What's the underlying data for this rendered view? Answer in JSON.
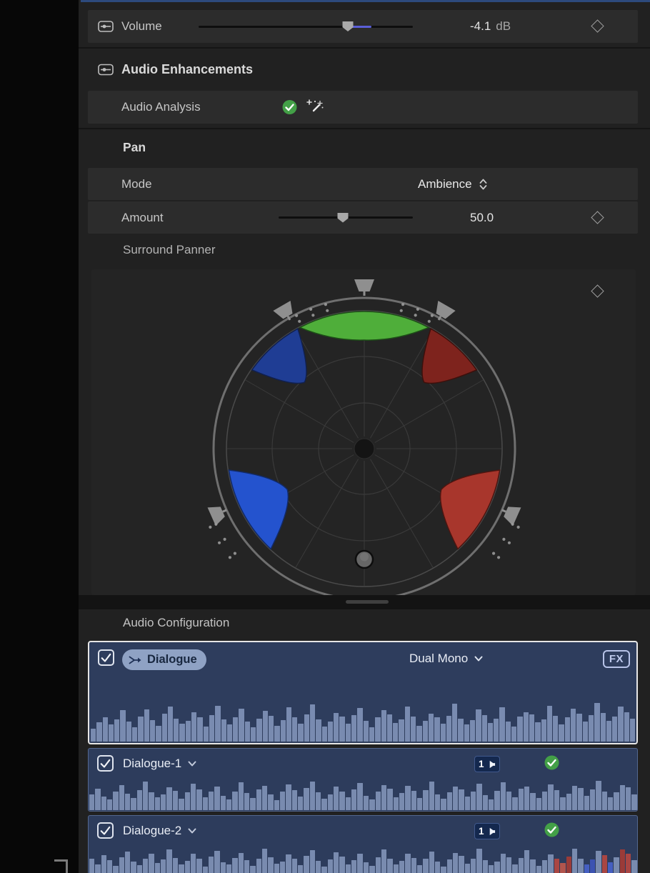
{
  "colors": {
    "accent_blue": "#5b5fd8",
    "selection_border": "#e6e6e6",
    "waveform": "#8a9cc2",
    "check_green": "#43a047"
  },
  "inspector": {
    "volume": {
      "label": "Volume",
      "value": "-4.1",
      "unit": "dB"
    },
    "audio_enhancements": {
      "title": "Audio Enhancements",
      "audio_analysis_label": "Audio Analysis"
    },
    "pan": {
      "title": "Pan",
      "mode_label": "Mode",
      "mode_value": "Ambience",
      "amount_label": "Amount",
      "amount_value": "50.0",
      "surround_panner_label": "Surround Panner"
    },
    "audio_configuration_title": "Audio Configuration"
  },
  "surround_panner": {
    "ring_color": "#6f6f6f",
    "circle_color": "#4a4a4a",
    "grid_color": "#3a3a3a",
    "speaker_color": "#8f8f8f",
    "dot_color": "#9a9a9a",
    "center_dot_color": "#141414",
    "puck_color": "#666666",
    "speakers": [
      {
        "name": "center",
        "angle": 90,
        "r": 228
      },
      {
        "name": "front-right",
        "angle": 60,
        "r": 222
      },
      {
        "name": "front-left",
        "angle": 120,
        "r": 222
      },
      {
        "name": "surround-right",
        "angle": 336,
        "r": 225
      },
      {
        "name": "surround-left",
        "angle": 204,
        "r": 225
      }
    ],
    "wedges": [
      {
        "name": "center",
        "angle": 90,
        "half": 28,
        "depth": 152,
        "fill": "#4fae3a",
        "stroke": "#1d4f17"
      },
      {
        "name": "front-left",
        "angle": 132,
        "half": 13,
        "depth": 125,
        "fill": "#1f3d94",
        "stroke": "#11204d"
      },
      {
        "name": "front-right",
        "angle": 48,
        "half": 13,
        "depth": 125,
        "fill": "#7e231d",
        "stroke": "#3c100c"
      },
      {
        "name": "surround-left",
        "angle": 208,
        "half": 19,
        "depth": 122,
        "fill": "#2453ce",
        "stroke": "#122a66"
      },
      {
        "name": "surround-right",
        "angle": 332,
        "half": 19,
        "depth": 122,
        "fill": "#a8362c",
        "stroke": "#4c1510"
      }
    ],
    "dot_arcs": [
      {
        "angles": [
          63,
          69,
          75
        ],
        "radii": [
          200,
          209
        ]
      },
      {
        "angles": [
          105,
          111,
          117
        ],
        "radii": [
          200,
          209
        ]
      },
      {
        "angles": [
          207,
          213,
          219
        ],
        "radii": [
          233,
          242
        ]
      },
      {
        "angles": [
          321,
          327,
          333
        ],
        "radii": [
          233,
          242
        ]
      }
    ],
    "puck": {
      "angle": 270,
      "radius": 155
    }
  },
  "audio_configuration": {
    "tracks": [
      {
        "name": "Dialogue",
        "format": "Dual Mono",
        "fx_label": "FX",
        "checked": true,
        "selected": true,
        "waveform": [
          0.32,
          0.48,
          0.61,
          0.42,
          0.55,
          0.78,
          0.5,
          0.36,
          0.62,
          0.8,
          0.54,
          0.4,
          0.7,
          0.88,
          0.58,
          0.44,
          0.52,
          0.74,
          0.6,
          0.38,
          0.66,
          0.9,
          0.55,
          0.42,
          0.6,
          0.82,
          0.5,
          0.35,
          0.58,
          0.76,
          0.64,
          0.4,
          0.54,
          0.86,
          0.6,
          0.45,
          0.68,
          0.92,
          0.56,
          0.38,
          0.5,
          0.72,
          0.62,
          0.44,
          0.66,
          0.84,
          0.52,
          0.36,
          0.6,
          0.78,
          0.68,
          0.46,
          0.56,
          0.88,
          0.62,
          0.4,
          0.52,
          0.7,
          0.6,
          0.44,
          0.64,
          0.94,
          0.58,
          0.42,
          0.54,
          0.8,
          0.66,
          0.46,
          0.58,
          0.86,
          0.5,
          0.38,
          0.62,
          0.74,
          0.68,
          0.48,
          0.56,
          0.9,
          0.64,
          0.42,
          0.6,
          0.82,
          0.7,
          0.5,
          0.66,
          0.96,
          0.72,
          0.52,
          0.62,
          0.88,
          0.74,
          0.58
        ]
      },
      {
        "name": "Dialogue-1",
        "channel_badge": "1",
        "checked": true,
        "analyzed": true,
        "waveform": [
          0.5,
          0.68,
          0.44,
          0.34,
          0.58,
          0.8,
          0.52,
          0.38,
          0.64,
          0.9,
          0.56,
          0.4,
          0.5,
          0.72,
          0.62,
          0.36,
          0.56,
          0.84,
          0.66,
          0.42,
          0.58,
          0.74,
          0.46,
          0.34,
          0.6,
          0.88,
          0.54,
          0.38,
          0.66,
          0.78,
          0.5,
          0.32,
          0.58,
          0.82,
          0.64,
          0.44,
          0.7,
          0.92,
          0.56,
          0.36,
          0.5,
          0.76,
          0.6,
          0.4,
          0.66,
          0.86,
          0.46,
          0.34,
          0.58,
          0.8,
          0.68,
          0.42,
          0.54,
          0.78,
          0.62,
          0.38,
          0.64,
          0.9,
          0.5,
          0.36,
          0.56,
          0.74,
          0.66,
          0.44,
          0.6,
          0.84,
          0.48,
          0.34,
          0.62,
          0.88,
          0.58,
          0.4,
          0.68,
          0.76,
          0.54,
          0.38,
          0.58,
          0.82,
          0.64,
          0.42,
          0.52,
          0.78,
          0.7,
          0.46,
          0.66,
          0.94,
          0.6,
          0.4,
          0.56,
          0.8,
          0.72,
          0.5
        ]
      },
      {
        "name": "Dialogue-2",
        "channel_badge": "1",
        "checked": true,
        "analyzed": true,
        "waveform": [
          0.58,
          0.42,
          0.7,
          0.54,
          0.36,
          0.64,
          0.82,
          0.5,
          0.38,
          0.6,
          0.76,
          0.46,
          0.56,
          0.88,
          0.62,
          0.4,
          0.52,
          0.74,
          0.58,
          0.34,
          0.66,
          0.84,
          0.48,
          0.42,
          0.62,
          0.78,
          0.54,
          0.36,
          0.58,
          0.9,
          0.64,
          0.44,
          0.5,
          0.72,
          0.6,
          0.38,
          0.68,
          0.86,
          0.52,
          0.34,
          0.56,
          0.8,
          0.66,
          0.42,
          0.54,
          0.76,
          0.48,
          0.36,
          0.64,
          0.88,
          0.58,
          0.4,
          0.52,
          0.74,
          0.62,
          0.38,
          0.6,
          0.82,
          0.5,
          0.34,
          0.56,
          0.78,
          0.68,
          0.44,
          0.58,
          0.92,
          0.54,
          0.38,
          0.5,
          0.76,
          0.64,
          0.42,
          0.62,
          0.86,
          0.56,
          0.36,
          0.54,
          0.72,
          0.6,
          0.46,
          0.66,
          0.9,
          0.58,
          0.42,
          0.56,
          0.84,
          0.7,
          0.48,
          0.64,
          0.88,
          0.74,
          0.54
        ],
        "waveform_colors": {
          "78": "#c4483e",
          "79": "#d05a4a",
          "80": "#b23a31",
          "83": "#4a66d8",
          "84": "#3f58c4",
          "86": "#c4483e",
          "87": "#4a66d8",
          "89": "#b23a31",
          "90": "#c4483e"
        }
      }
    ]
  }
}
